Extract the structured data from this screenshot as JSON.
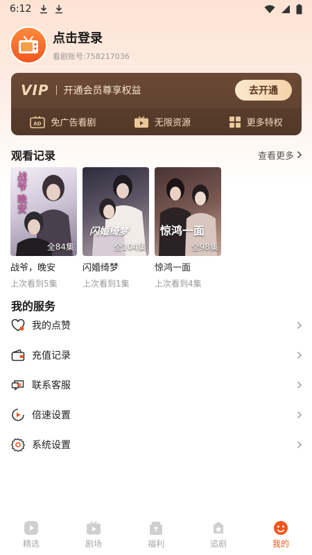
{
  "status_bar": {
    "time": "6:12"
  },
  "profile": {
    "login_text": "点击登录",
    "account_label": "看剧账号:758217036"
  },
  "vip": {
    "logo": "VIP",
    "description": "开通会员尊享权益",
    "cta": "去开通",
    "perks": [
      {
        "label": "免广告看剧",
        "icon": "ad-free-icon"
      },
      {
        "label": "无限资源",
        "icon": "unlimited-tv-icon"
      },
      {
        "label": "更多特权",
        "icon": "grid-icon"
      }
    ]
  },
  "history": {
    "title": "观看记录",
    "see_more": "查看更多",
    "items": [
      {
        "title": "战爷，晚安",
        "episodes": "全84集",
        "progress": "上次看到5集",
        "poster_text": "战爷 晚安",
        "colors": [
          "#e9e3ee",
          "#b9b2c7",
          "#6d6478"
        ]
      },
      {
        "title": "闪婚绮梦",
        "episodes": "全104集",
        "progress": "上次看到1集",
        "poster_text": "闪婚绮梦",
        "colors": [
          "#3a3a4a",
          "#7f6f78",
          "#c9b8b9"
        ]
      },
      {
        "title": "惊鸿一面",
        "episodes": "全98集",
        "progress": "上次看到4集",
        "poster_text": "惊鸿一面",
        "colors": [
          "#3b2a2a",
          "#6a4a43",
          "#b39387"
        ]
      }
    ]
  },
  "services": {
    "title": "我的服务",
    "items": [
      {
        "label": "我的点赞",
        "icon": "heart-icon"
      },
      {
        "label": "充值记录",
        "icon": "wallet-icon"
      },
      {
        "label": "联系客服",
        "icon": "chat-icon"
      },
      {
        "label": "倍速设置",
        "icon": "speed-icon"
      },
      {
        "label": "系统设置",
        "icon": "gear-icon"
      }
    ]
  },
  "nav": {
    "items": [
      {
        "label": "精选",
        "icon": "play-icon",
        "active": false
      },
      {
        "label": "剧场",
        "icon": "tv-icon",
        "active": false
      },
      {
        "label": "福利",
        "icon": "gift-icon",
        "active": false
      },
      {
        "label": "追剧",
        "icon": "star-icon",
        "active": false
      },
      {
        "label": "我的",
        "icon": "smiley-icon",
        "active": true
      }
    ]
  },
  "colors": {
    "accent": "#f2561d",
    "vip_bg": "#5e402e",
    "vip_gold": "#f3d9b5"
  }
}
